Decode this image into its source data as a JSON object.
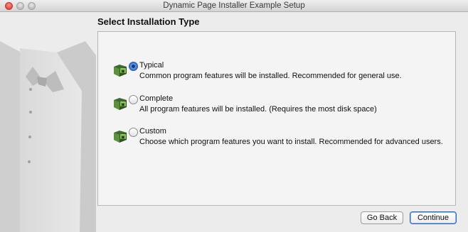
{
  "window": {
    "title": "Dynamic Page Installer Example Setup",
    "controls": [
      "close",
      "minimize",
      "zoom"
    ]
  },
  "page": {
    "heading": "Select Installation Type"
  },
  "installation_types": [
    {
      "title": "Typical",
      "description": "Common program features will be installed. Recommended for general use.",
      "selected": true,
      "icon": "installer-package-icon"
    },
    {
      "title": "Complete",
      "description": "All program features will be installed. (Requires the most disk space)",
      "selected": false,
      "icon": "installer-package-icon"
    },
    {
      "title": "Custom",
      "description": "Choose which program features you want to install. Recommended for advanced users.",
      "selected": false,
      "icon": "installer-package-icon"
    }
  ],
  "buttons": {
    "back": "Go Back",
    "continue": "Continue"
  },
  "colors": {
    "window_bg": "#ececec",
    "panel_bg": "#f4f4f4",
    "radio_selected": "#2f6bc8",
    "default_button_border": "#2f64b8"
  }
}
